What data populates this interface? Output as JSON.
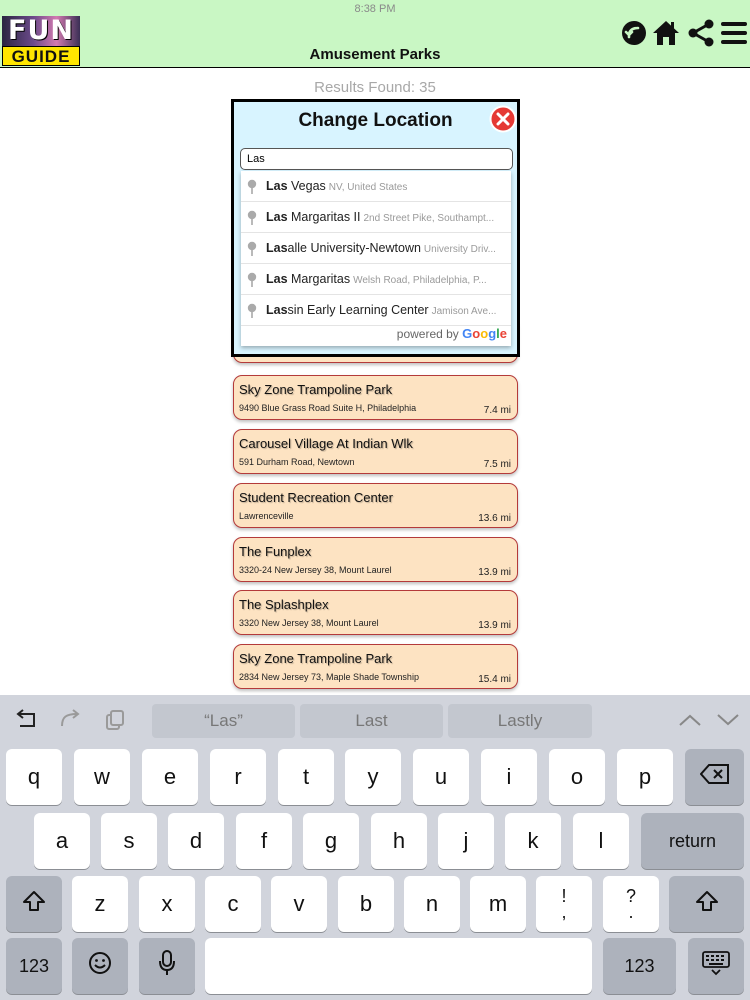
{
  "status": {
    "time": "8:38 PM"
  },
  "header": {
    "logo_top": "FUN",
    "logo_bottom": "GUIDE",
    "title": "Amusement Parks",
    "icons": [
      "back-icon",
      "home-icon",
      "share-icon",
      "menu-icon"
    ]
  },
  "results": {
    "label": "Results Found: 35"
  },
  "modal": {
    "title": "Change Location",
    "search_value": "Las",
    "suggestions": [
      {
        "match": "Las",
        "rest": " Vegas",
        "sub": "NV, United States"
      },
      {
        "match": "Las",
        "rest": " Margaritas II",
        "sub": "2nd Street Pike, Southampt..."
      },
      {
        "match": "Las",
        "rest": "alle University-Newtown",
        "sub": "University Driv..."
      },
      {
        "match": "Las",
        "rest": " Margaritas",
        "sub": "Welsh Road, Philadelphia, P..."
      },
      {
        "match": "Las",
        "rest": "sin Early Learning Center",
        "sub": "Jamison Ave..."
      }
    ],
    "powered_by": "powered by",
    "google": [
      "G",
      "o",
      "o",
      "g",
      "l",
      "e"
    ]
  },
  "places": [
    {
      "name": "Sky Zone Trampoline Park",
      "address": "9490 Blue Grass Road Suite H, Philadelphia",
      "distance": "7.4 mi"
    },
    {
      "name": "Carousel Village At Indian Wlk",
      "address": "591 Durham Road, Newtown",
      "distance": "7.5 mi"
    },
    {
      "name": "Student Recreation Center",
      "address": "Lawrenceville",
      "distance": "13.6 mi"
    },
    {
      "name": "The Funplex",
      "address": "3320-24 New Jersey 38, Mount Laurel",
      "distance": "13.9 mi"
    },
    {
      "name": "The Splashplex",
      "address": "3320 New Jersey 38, Mount Laurel",
      "distance": "13.9 mi"
    },
    {
      "name": "Sky Zone Trampoline Park",
      "address": "2834 New Jersey 73, Maple Shade Township",
      "distance": "15.4 mi"
    }
  ],
  "keyboard": {
    "predictions": [
      "“Las”",
      "Last",
      "Lastly"
    ],
    "row1": [
      "q",
      "w",
      "e",
      "r",
      "t",
      "y",
      "u",
      "i",
      "o",
      "p"
    ],
    "row2": [
      "a",
      "s",
      "d",
      "f",
      "g",
      "h",
      "j",
      "k",
      "l"
    ],
    "return_label": "return",
    "row3": [
      "z",
      "x",
      "c",
      "v",
      "b",
      "n",
      "m"
    ],
    "punct1": "!\n,",
    "punct2": "?\n.",
    "numbers_label": "123"
  },
  "colors": {
    "header_bg": "#c9f7c4",
    "card_bg": "#fde3c2",
    "card_border": "#b43a3a",
    "modal_bg": "#d8f4ff",
    "close_red": "#e53935"
  }
}
